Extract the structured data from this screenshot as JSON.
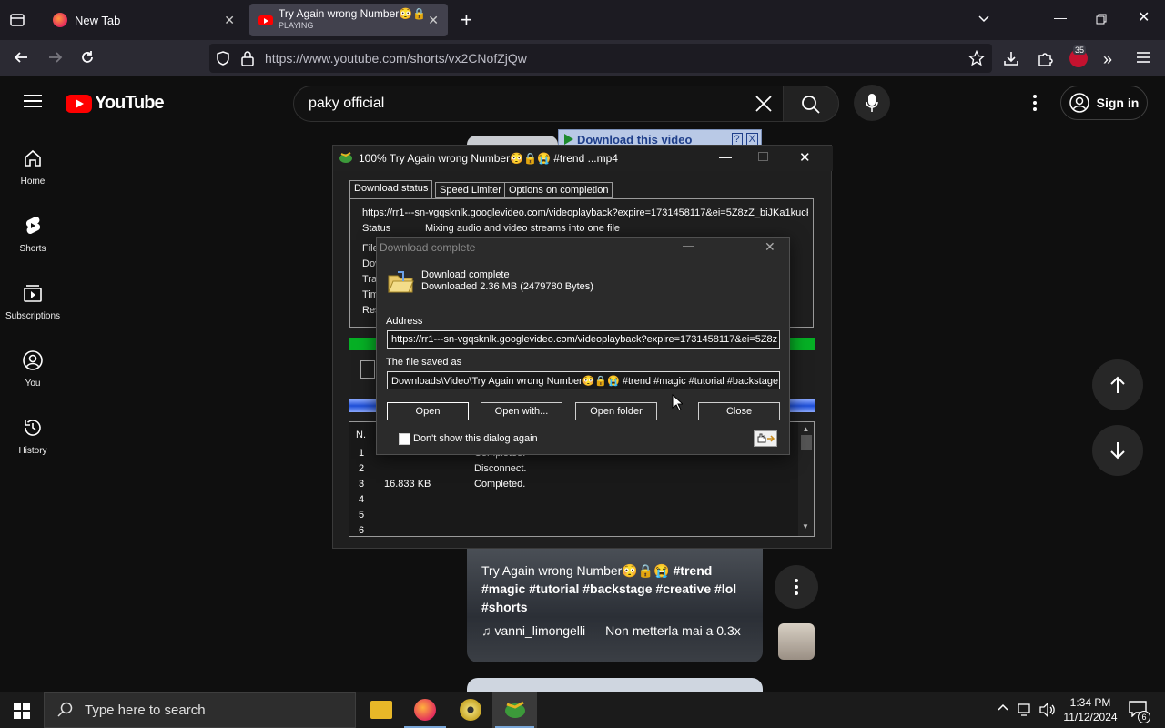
{
  "browser": {
    "tabs": [
      {
        "title": "New Tab",
        "subtitle": ""
      },
      {
        "title": "Try Again wrong Number😳🔒",
        "subtitle": "PLAYING"
      }
    ],
    "url": "https://www.youtube.com/shorts/vx2CNofZjQw",
    "extension_badge": "35"
  },
  "youtube": {
    "logo_text": "YouTube",
    "search_value": "paky official",
    "sign_in_label": "Sign in",
    "sidebar": [
      {
        "label": "Home",
        "icon": "home-icon"
      },
      {
        "label": "Shorts",
        "icon": "shorts-icon"
      },
      {
        "label": "Subscriptions",
        "icon": "subscriptions-icon"
      },
      {
        "label": "You",
        "icon": "you-icon"
      },
      {
        "label": "History",
        "icon": "history-icon"
      }
    ],
    "short": {
      "title_plain": "Try Again wrong Number😳🔒😭 ",
      "title_tags": "#trend #magic #tutorial #backstage #creative #lol #shorts",
      "channel": "vanni_limongelli",
      "sound": "Non metterla mai a 0.3x"
    },
    "download_video_label": "Download this video"
  },
  "idm": {
    "title": "100% Try Again wrong Number😳🔒😭 #trend ...mp4",
    "tabs": [
      "Download status",
      "Speed Limiter",
      "Options on completion"
    ],
    "url": "https://rr1---sn-vgqsknlk.googlevideo.com/videoplayback?expire=1731458117&ei=5Z8zZ_biJKa1kucP",
    "status_label": "Status",
    "status_value": "Mixing audio and video streams into one file",
    "partial_labels": [
      "File",
      "Dov",
      "Tra",
      "Tim",
      "Res"
    ],
    "progress_fraction": 1.0,
    "table": {
      "header": "N.",
      "rows": [
        {
          "n": "1",
          "size": "",
          "status": "Completed."
        },
        {
          "n": "2",
          "size": "",
          "status": "Disconnect."
        },
        {
          "n": "3",
          "size": "16.833  KB",
          "status": "Completed."
        },
        {
          "n": "4",
          "size": "",
          "status": ""
        },
        {
          "n": "5",
          "size": "",
          "status": ""
        },
        {
          "n": "6",
          "size": "",
          "status": ""
        }
      ]
    }
  },
  "popup": {
    "title": "Download complete",
    "heading": "Download complete",
    "downloaded": "Downloaded 2.36  MB (2479780 Bytes)",
    "address_label": "Address",
    "address_value": "https://rr1---sn-vgqsknlk.googlevideo.com/videoplayback?expire=1731458117&ei=5Z8z",
    "saved_label": "The file saved as",
    "saved_value": "Downloads\\Video\\Try Again wrong Number😳🔒😭 #trend #magic #tutorial #backstage #",
    "buttons": [
      "Open",
      "Open with...",
      "Open folder",
      "Close"
    ],
    "checkbox_label": "Don't show this dialog again"
  },
  "taskbar": {
    "search_placeholder": "Type here to search",
    "time": "1:34 PM",
    "date": "11/12/2024",
    "notification_count": "6"
  },
  "colors": {
    "youtube_red": "#ff0000",
    "progress_green": "#06b025"
  }
}
